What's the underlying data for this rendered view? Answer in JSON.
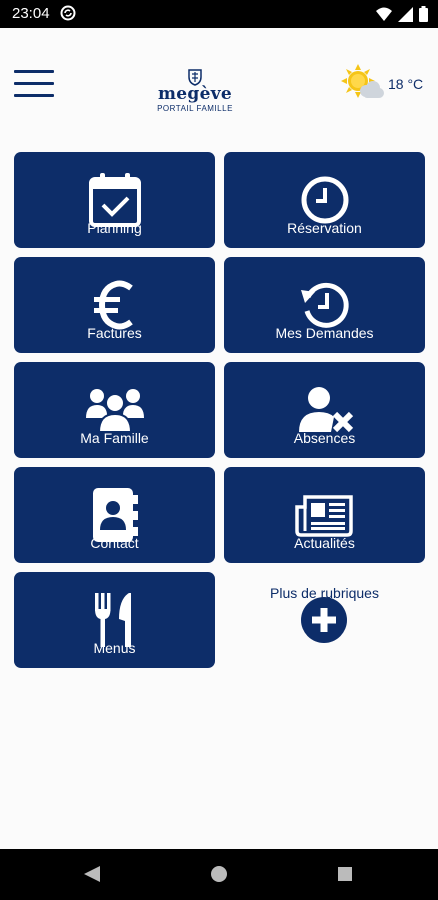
{
  "status": {
    "time": "23:04"
  },
  "header": {
    "logo_name": "megève",
    "logo_subtitle": "PORTAIL FAMILLE",
    "temperature": "18 °C"
  },
  "tiles": [
    {
      "label": "Planning",
      "icon": "calendar-check-icon"
    },
    {
      "label": "Réservation",
      "icon": "clock-icon"
    },
    {
      "label": "Factures",
      "icon": "euro-icon"
    },
    {
      "label": "Mes Demandes",
      "icon": "history-icon"
    },
    {
      "label": "Ma Famille",
      "icon": "family-icon"
    },
    {
      "label": "Absences",
      "icon": "user-remove-icon"
    },
    {
      "label": "Contact",
      "icon": "address-book-icon"
    },
    {
      "label": "Actualités",
      "icon": "newspaper-icon"
    },
    {
      "label": "Menus",
      "icon": "cutlery-icon"
    }
  ],
  "more": {
    "label": "Plus de rubriques",
    "icon": "plus-circle-icon"
  },
  "colors": {
    "primary": "#0d2d69",
    "background": "#fbfbfb",
    "sun": "#f5c518"
  }
}
